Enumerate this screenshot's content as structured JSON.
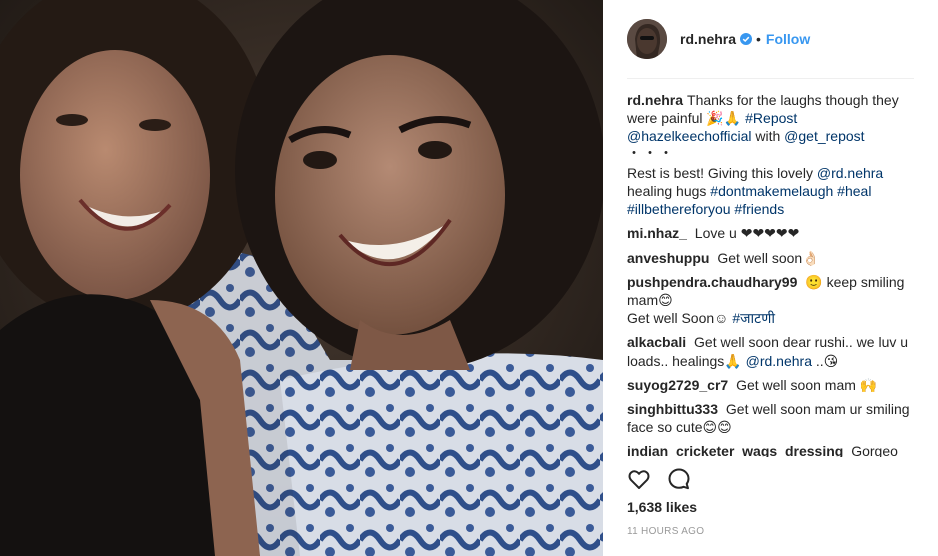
{
  "post": {
    "owner": "rd.nehra",
    "follow_label": "Follow",
    "separator": "•",
    "likes": "1,638 likes",
    "time_ago": "11 HOURS AGO"
  },
  "caption": {
    "user": "rd.nehra",
    "text_a": "Thanks for the laughs though they were painful 🎉🙏 ",
    "hashtag_repost": "#Repost",
    "mention_hazel": "@hazelkeechofficial",
    "text_with": " with ",
    "mention_getrepost": "@get_repost",
    "more": "・・・",
    "text_b": "Rest is best! Giving this lovely ",
    "mention_rd": "@rd.nehra",
    "text_c": " healing hugs ",
    "hashtag_1": "#dontmakemelaugh",
    "hashtag_2": "#heal",
    "hashtag_3": "#illbethereforyou",
    "hashtag_4": "#friends"
  },
  "comments": [
    {
      "user": "mi.nhaz_",
      "text": "Love u ❤❤❤❤❤"
    },
    {
      "user": "anveshuppu",
      "text": "Get well soon👌🏻"
    },
    {
      "user": "pushpendra.chaudhary99",
      "text_a": "🙂 keep smiling mam😊",
      "text_b": "Get well Soon☺ ",
      "hashtag": "#जाटणी"
    },
    {
      "user": "alkacbali",
      "text_a": "Get well soon dear rushi.. we luv u loads.. healings🙏 ",
      "mention": "@rd.nehra",
      "text_b": " ..😘"
    },
    {
      "user": "suyog2729_cr7",
      "text": "Get well soon mam 🙌"
    },
    {
      "user": "singhbittu333",
      "text": "Get well soon mam ur smiling face so cute😊😊"
    },
    {
      "user": "indian_cricketer_wags_dressing",
      "text": "Gorgeo"
    }
  ],
  "icons": {
    "verified": "verified-badge-icon",
    "like": "heart-icon",
    "comment": "comment-bubble-icon"
  },
  "colors": {
    "link": "#003569",
    "follow": "#3897f0",
    "verified": "#3897f0",
    "timestamp": "#999999"
  }
}
